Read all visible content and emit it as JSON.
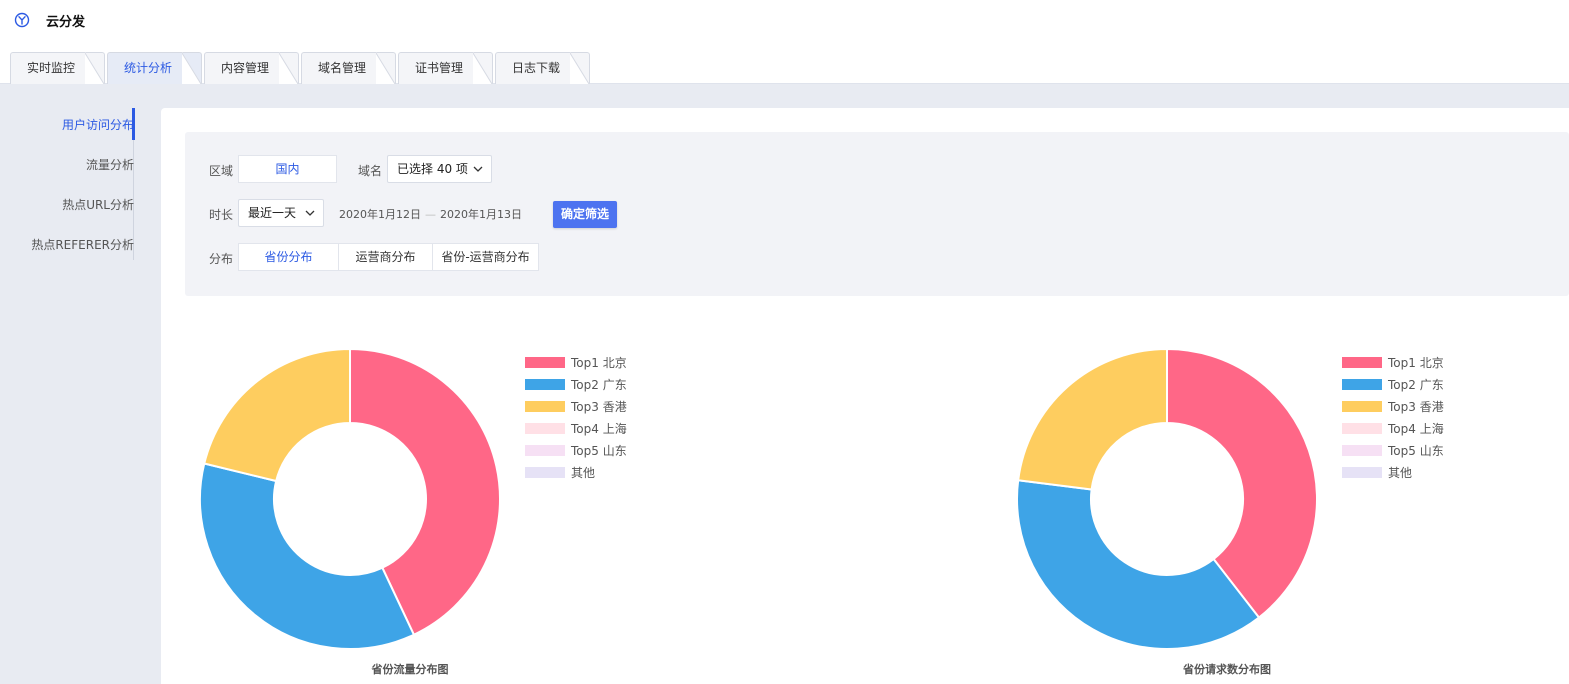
{
  "header": {
    "title": "云分发",
    "logo_icon": "cloud-logo-icon"
  },
  "tabs": [
    {
      "label": "实时监控",
      "active": false
    },
    {
      "label": "统计分析",
      "active": true
    },
    {
      "label": "内容管理",
      "active": false
    },
    {
      "label": "域名管理",
      "active": false
    },
    {
      "label": "证书管理",
      "active": false
    },
    {
      "label": "日志下载",
      "active": false
    }
  ],
  "sidebar": {
    "items": [
      {
        "label": "用户访问分布",
        "active": true
      },
      {
        "label": "流量分析",
        "active": false
      },
      {
        "label": "热点URL分析",
        "active": false
      },
      {
        "label": "热点REFERER分析",
        "active": false
      }
    ]
  },
  "filters": {
    "region": {
      "label": "区域",
      "value": "国内"
    },
    "domain": {
      "label": "域名",
      "value": "已选择 40 项"
    },
    "duration": {
      "label": "时长",
      "value": "最近一天"
    },
    "date_range": {
      "start": "2020年1月12日",
      "separator": "—",
      "end": "2020年1月13日"
    },
    "confirm_label": "确定筛选",
    "distribution": {
      "label": "分布",
      "options": [
        {
          "label": "省份分布",
          "active": true
        },
        {
          "label": "运营商分布",
          "active": false
        },
        {
          "label": "省份-运营商分布",
          "active": false
        }
      ]
    }
  },
  "colors": {
    "accent": "#2c5ae3",
    "button": "#4d73f0"
  },
  "chart_data": [
    {
      "type": "pie",
      "donut": true,
      "title": "省份流量分布图",
      "legend_position": "right",
      "series": [
        {
          "name": "Top1 北京",
          "value": 43,
          "color": "#ff6787"
        },
        {
          "name": "Top2 广东",
          "value": 35.8,
          "color": "#3ea4e7"
        },
        {
          "name": "Top3 香港",
          "value": 21.2,
          "color": "#fecd5f"
        },
        {
          "name": "Top4 上海",
          "value": 0,
          "color": "#ffe0e6"
        },
        {
          "name": "Top5 山东",
          "value": 0,
          "color": "#f6e0f4"
        },
        {
          "name": "其他",
          "value": 0,
          "color": "#e6e2f6"
        }
      ]
    },
    {
      "type": "pie",
      "donut": true,
      "title": "省份请求数分布图",
      "legend_position": "right",
      "series": [
        {
          "name": "Top1 北京",
          "value": 39.5,
          "color": "#ff6787"
        },
        {
          "name": "Top2 广东",
          "value": 37.5,
          "color": "#3ea4e7"
        },
        {
          "name": "Top3 香港",
          "value": 23,
          "color": "#fecd5f"
        },
        {
          "name": "Top4 上海",
          "value": 0,
          "color": "#ffe0e6"
        },
        {
          "name": "Top5 山东",
          "value": 0,
          "color": "#f6e0f4"
        },
        {
          "name": "其他",
          "value": 0,
          "color": "#e6e2f6"
        }
      ]
    }
  ]
}
